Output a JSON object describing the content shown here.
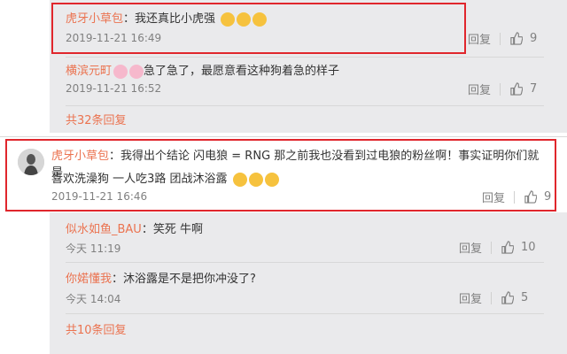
{
  "thread1": {
    "comments": [
      {
        "user": "虎牙小草包",
        "text": "：我还真比小虎强",
        "emoji": [
          "dog",
          "dog",
          "dog"
        ],
        "time": "2019-11-21 16:49",
        "reply": "回复",
        "likes": "9"
      },
      {
        "user": "横滨元町",
        "text": "急了急了，最愿意看这种狗着急的样子",
        "emoji": [
          "pig",
          "pig"
        ],
        "time": "2019-11-21 16:52",
        "reply": "回复",
        "likes": "7"
      }
    ],
    "more": "共32条回复"
  },
  "main_comment": {
    "user": "虎牙小草包",
    "text_line1": "：我得出个结论 闪电狼 = RNG 那之前我也没看到过电狼的粉丝啊！事实证明你们就是",
    "text_line2": "喜欢洗澡狗 一人吃3路 团战沐浴露",
    "emoji": [
      "dog",
      "dog",
      "dog"
    ],
    "time": "2019-11-21 16:46",
    "reply": "回复",
    "likes": "9"
  },
  "replies": [
    {
      "user": "似水如鱼_BAU",
      "text": "：笑死 牛啊",
      "time": "今天 11:19",
      "reply": "回复",
      "likes": "10"
    },
    {
      "user": "你婼懂我",
      "text": "：沐浴露是不是把你冲没了?",
      "time": "今天 14:04",
      "reply": "回复",
      "likes": "5"
    }
  ],
  "replies_more": "共10条回复",
  "colors": {
    "username": "#eb7350",
    "highlight_box": "#e0262c",
    "panel_bg": "#eaeaec"
  }
}
